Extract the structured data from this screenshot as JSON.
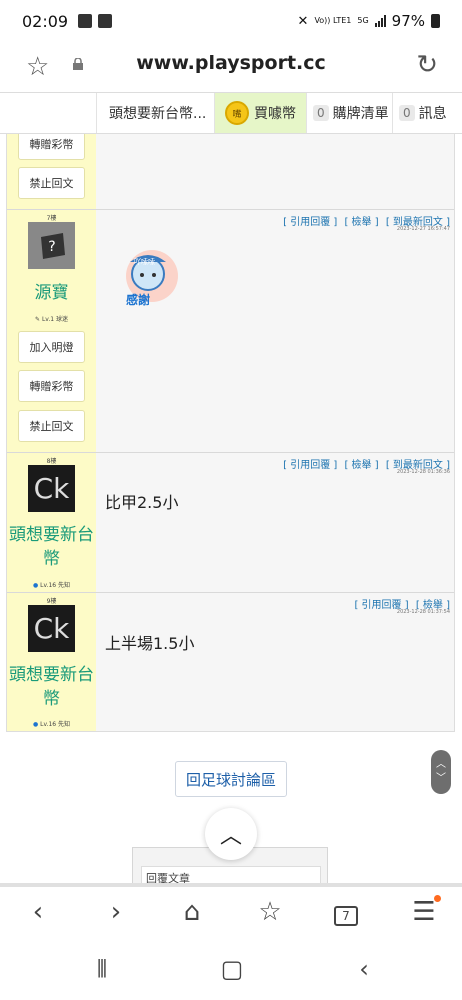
{
  "status_bar": {
    "time": "02:09",
    "network": "Vo)) LTE1",
    "network_type": "5G",
    "battery": "97%"
  },
  "address_bar": {
    "url": "www.playsport.cc"
  },
  "site_nav": {
    "user_tab": "頭想要新台幣...",
    "coin_icon_text": "嘴",
    "buy_coins": "買噱幣",
    "cart_count": "0",
    "cart_label": "購牌清單",
    "msg_count": "0",
    "msg_label": "訊息"
  },
  "posts": {
    "partial": {
      "gift_button": "轉贈彩幣",
      "ban_button": "禁止回文"
    },
    "post7": {
      "floor": "7樓",
      "username": "源寶",
      "level": "Lv.1 球迷",
      "links": [
        "[ 引用回覆 ]",
        "[ 檢舉 ]",
        "[ 到最新回文 ]"
      ],
      "timestamp": "2023-12-27 16:57:47",
      "sticker_text_top": "吖嗦嗦",
      "sticker_text_bottom": "感謝",
      "add_lamp_button": "加入明燈",
      "gift_button": "轉贈彩幣",
      "ban_button": "禁止回文"
    },
    "post8": {
      "floor": "8樓",
      "avatar_text": "Ck",
      "username": "頭想要新台幣",
      "level": "Lv.16 先知",
      "links": [
        "[ 引用回覆 ]",
        "[ 檢舉 ]",
        "[ 到最新回文 ]"
      ],
      "timestamp": "2023-12-28 01:36:36",
      "message": "比甲2.5小"
    },
    "post9": {
      "floor": "9樓",
      "avatar_text": "Ck",
      "username": "頭想要新台幣",
      "level": "Lv.16 先知",
      "links": [
        "[ 引用回覆 ]",
        "[ 檢舉 ]"
      ],
      "timestamp": "2023-12-28 01:37:54",
      "message": "上半場1.5小"
    }
  },
  "footer": {
    "back_button": "回足球討論區",
    "reply_label": "回覆文章"
  },
  "browser_bar": {
    "tab_count": "7"
  }
}
